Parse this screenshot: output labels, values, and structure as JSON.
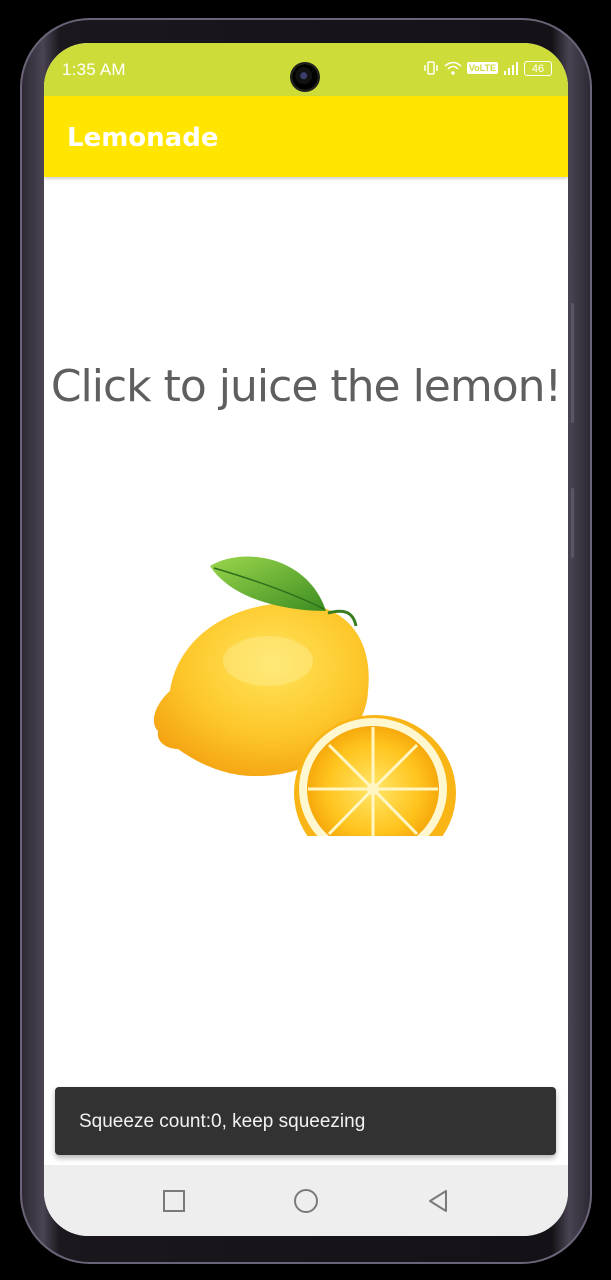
{
  "status_bar": {
    "time": "1:35 AM",
    "battery": "46",
    "network_badge": "VoLTE",
    "icons": [
      "vibrate-icon",
      "wifi-icon",
      "signal-icon",
      "battery-icon"
    ],
    "color": "#cddc39"
  },
  "app_bar": {
    "title": "Lemonade",
    "color": "#ffe500"
  },
  "main": {
    "instruction": "Click to juice the lemon!",
    "image": "lemon-tree-image"
  },
  "snackbar": {
    "message": "Squeeze count:0, keep squeezing"
  },
  "nav_bar": {
    "buttons": [
      "recents-button",
      "home-button",
      "back-button"
    ]
  }
}
